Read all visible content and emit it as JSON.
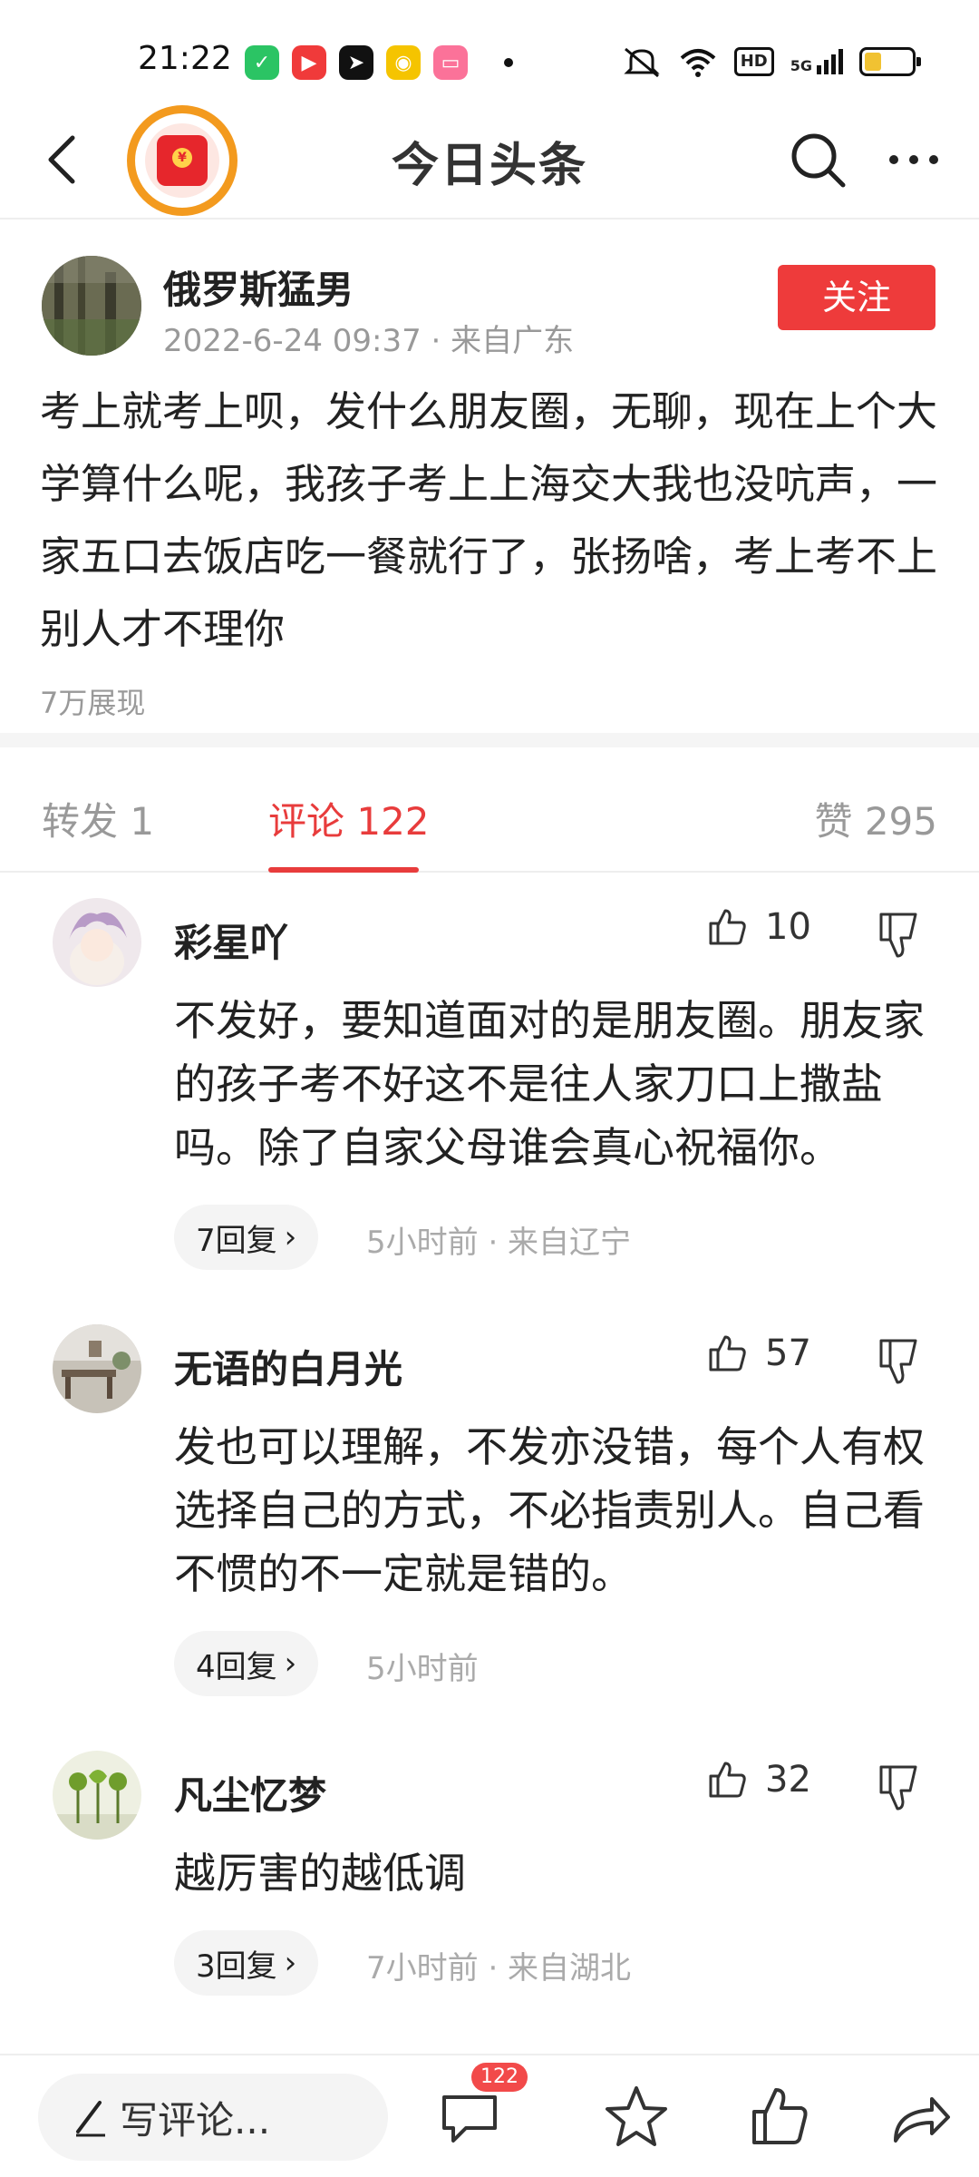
{
  "status_bar": {
    "time": "21:22",
    "app_icons": [
      "wechat-icon",
      "video-app-icon",
      "capcut-icon",
      "weibo-icon",
      "bilibili-icon"
    ],
    "hd_label": "HD",
    "network_label": "5G"
  },
  "header": {
    "title": "今日头条"
  },
  "post": {
    "author": "俄罗斯猛男",
    "meta": "2022-6-24 09:37 · 来自广东",
    "follow_label": "关注",
    "text": "考上就考上呗，发什么朋友圈，无聊，现在上个大学算什么呢，我孩子考上上海交大我也没吭声，一家五口去饭店吃一餐就行了，张扬啥，考上考不上别人才不理你",
    "views": "7万展现"
  },
  "tabs": {
    "repost": "转发 1",
    "comments": "评论 122",
    "likes": "赞 295",
    "active": "comments"
  },
  "comments": [
    {
      "name": "彩星吖",
      "likes": "10",
      "text": "不发好，要知道面对的是朋友圈。朋友家的孩子考不好这不是往人家刀口上撒盐吗。除了自家父母谁会真心祝福你。",
      "replies": "7回复",
      "meta": "5小时前 · 来自辽宁"
    },
    {
      "name": "无语的白月光",
      "likes": "57",
      "text": "发也可以理解，不发亦没错，每个人有权选择自己的方式，不必指责别人。自己看不惯的不一定就是错的。",
      "replies": "4回复",
      "meta": "5小时前"
    },
    {
      "name": "凡尘忆梦",
      "likes": "32",
      "text": "越厉害的越低调",
      "replies": "3回复",
      "meta": "7小时前 · 来自湖北"
    }
  ],
  "bottom_bar": {
    "write_placeholder": "写评论...",
    "comment_badge": "122"
  },
  "colors": {
    "accent_red": "#ee3b3b",
    "gray_text": "#999999"
  }
}
